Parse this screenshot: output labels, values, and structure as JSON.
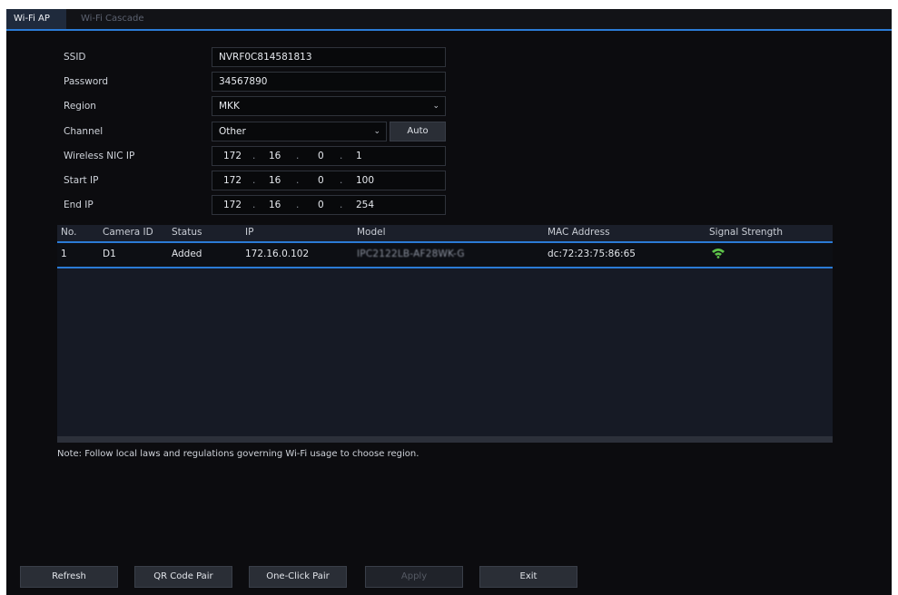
{
  "tabs": [
    {
      "label": "Wi-Fi AP",
      "active": true
    },
    {
      "label": "Wi-Fi Cascade",
      "active": false
    }
  ],
  "form": {
    "ssid": {
      "label": "SSID",
      "value": "NVRF0C814581813"
    },
    "password": {
      "label": "Password",
      "value": "34567890"
    },
    "region": {
      "label": "Region",
      "value": "MKK"
    },
    "channel": {
      "label": "Channel",
      "value": "Other",
      "auto_label": "Auto"
    },
    "wireless_nic_ip": {
      "label": "Wireless NIC IP",
      "octets": [
        "172",
        "16",
        "0",
        "1"
      ]
    },
    "start_ip": {
      "label": "Start IP",
      "octets": [
        "172",
        "16",
        "0",
        "100"
      ]
    },
    "end_ip": {
      "label": "End IP",
      "octets": [
        "172",
        "16",
        "0",
        "254"
      ]
    }
  },
  "table": {
    "columns": [
      "No.",
      "Camera ID",
      "Status",
      "IP",
      "Model",
      "MAC Address",
      "Signal Strength"
    ],
    "rows": [
      {
        "no": "1",
        "camera_id": "D1",
        "status": "Added",
        "ip": "172.16.0.102",
        "model": "IPC2122LB-AF28WK-G",
        "mac": "dc:72:23:75:86:65",
        "signal_icon": "wifi-signal-icon"
      }
    ]
  },
  "note": "Note: Follow local laws and regulations governing Wi-Fi usage to choose region.",
  "buttons": {
    "refresh": "Refresh",
    "qr_code_pair": "QR Code Pair",
    "one_click_pair": "One-Click Pair",
    "apply": "Apply",
    "exit": "Exit"
  },
  "colors": {
    "accent": "#2b7bd6",
    "background": "#0c0c0f",
    "signal": "#5ec44a"
  }
}
